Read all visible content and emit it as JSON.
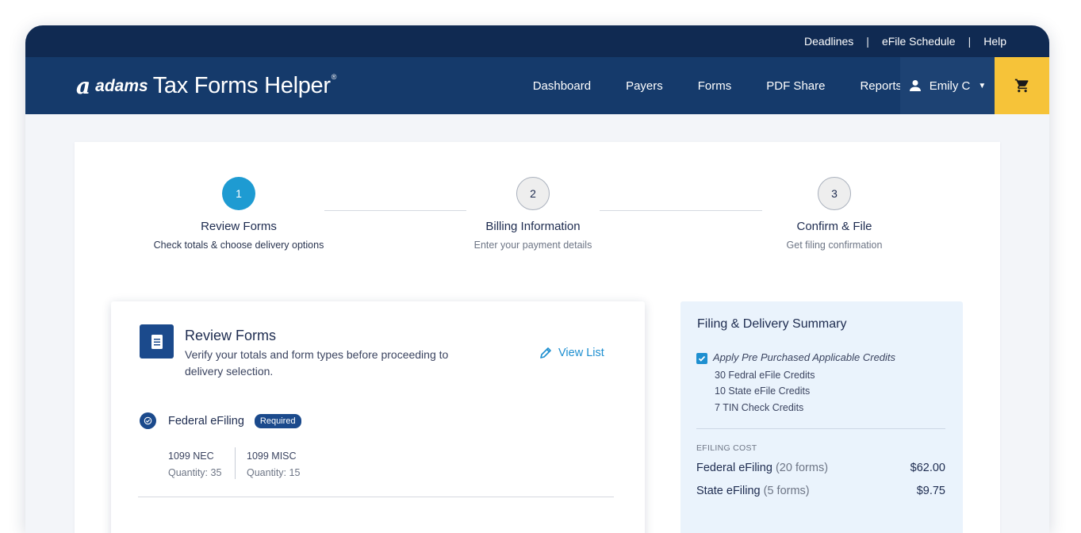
{
  "utility_nav": {
    "links": [
      "Deadlines",
      "eFile Schedule",
      "Help"
    ],
    "separator": "|"
  },
  "brand": {
    "mark": "a",
    "name": "adams",
    "product": "Tax Forms Helper",
    "registered": "®"
  },
  "main_nav": {
    "items": [
      "Dashboard",
      "Payers",
      "Forms",
      "PDF Share",
      "Reports"
    ]
  },
  "user": {
    "name": "Emily C"
  },
  "colors": {
    "nav_dark": "#102a52",
    "nav": "#153a6b",
    "accent_yellow": "#f6c339",
    "step_active": "#1e9bd2",
    "primary": "#1b4a8c",
    "link": "#1e8fd0"
  },
  "steps": [
    {
      "number": "1",
      "title": "Review Forms",
      "subtitle": "Check totals & choose delivery options",
      "state": "active"
    },
    {
      "number": "2",
      "title": "Billing Information",
      "subtitle": "Enter your payment details",
      "state": "upcoming"
    },
    {
      "number": "3",
      "title": "Confirm & File",
      "subtitle": "Get filing confirmation",
      "state": "upcoming"
    }
  ],
  "review": {
    "title": "Review Forms",
    "description": "Verify your totals and form types before proceeding to delivery selection.",
    "view_list_label": "View List",
    "federal": {
      "label": "Federal eFiling",
      "badge": "Required",
      "forms": [
        {
          "name": "1099 NEC",
          "quantity": "Quantity: 35"
        },
        {
          "name": "1099 MISC",
          "quantity": "Quantity: 15"
        }
      ]
    }
  },
  "summary": {
    "title": "Filing & Delivery Summary",
    "apply_credits_label": "Apply Pre Purchased Applicable Credits",
    "apply_credits_checked": true,
    "credits": [
      "30 Fedral eFile Credits",
      "10 State eFile Credits",
      "7 TIN Check Credits"
    ],
    "cost_heading": "EFILING COST",
    "costs": [
      {
        "label": "Federal eFiling",
        "count": "(20 forms)",
        "amount": "$62.00"
      },
      {
        "label": "State eFiling",
        "count": "(5 forms)",
        "amount": "$9.75"
      }
    ]
  }
}
